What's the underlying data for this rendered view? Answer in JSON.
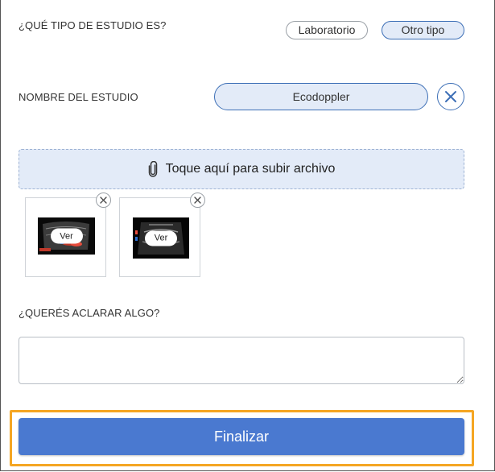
{
  "study_type": {
    "question": "¿QUÉ TIPO DE ESTUDIO ES?",
    "options": [
      {
        "label": "Laboratorio",
        "selected": false
      },
      {
        "label": "Otro tipo",
        "selected": true
      }
    ]
  },
  "study_name": {
    "label": "NOMBRE DEL ESTUDIO",
    "value": "Ecodoppler",
    "clear_icon": "close-icon"
  },
  "upload": {
    "icon": "paperclip-icon",
    "label": "Toque aquí para subir archivo"
  },
  "attachments": [
    {
      "view_label": "Ver",
      "remove_icon": "close-icon"
    },
    {
      "view_label": "Ver",
      "remove_icon": "close-icon"
    }
  ],
  "notes": {
    "question": "¿QUERÉS ACLARAR ALGO?",
    "value": ""
  },
  "finish_button": {
    "label": "Finalizar",
    "color": "#4a79d0",
    "highlight_color": "#f5a623"
  },
  "colors": {
    "accent": "#3d6fb6",
    "selected_bg": "#e3ebf8"
  }
}
